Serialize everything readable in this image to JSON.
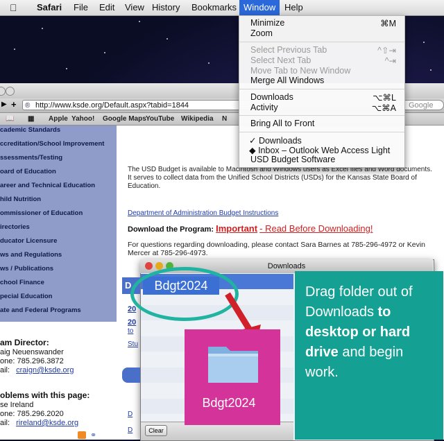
{
  "menubar": {
    "apple": "",
    "items": [
      "Safari",
      "File",
      "Edit",
      "View",
      "History",
      "Bookmarks",
      "Window",
      "Help"
    ],
    "active": "Window"
  },
  "window_menu": {
    "items": [
      {
        "label": "Minimize",
        "shortcut": "⌘M",
        "enabled": true
      },
      {
        "label": "Zoom",
        "shortcut": "",
        "enabled": true
      },
      {
        "label": "Select Previous Tab",
        "shortcut": "^⇧⇥",
        "enabled": false
      },
      {
        "label": "Select Next Tab",
        "shortcut": "^⇥",
        "enabled": false
      },
      {
        "label": "Move Tab to New Window",
        "shortcut": "",
        "enabled": false
      },
      {
        "label": "Merge All Windows",
        "shortcut": "",
        "enabled": true
      },
      {
        "label": "Downloads",
        "shortcut": "⌥⌘L",
        "enabled": true
      },
      {
        "label": "Activity",
        "shortcut": "⌥⌘A",
        "enabled": true
      },
      {
        "label": "Bring All to Front",
        "shortcut": "",
        "enabled": true
      },
      {
        "label": "✓ Downloads",
        "shortcut": "",
        "enabled": true
      },
      {
        "label": "◆ Inbox – Outlook Web Access Light",
        "shortcut": "",
        "enabled": true
      },
      {
        "label": "USD Budget Software",
        "shortcut": "",
        "enabled": true
      }
    ]
  },
  "browser": {
    "url": "http://www.ksde.org/Default.aspx?tabid=1844",
    "search_placeholder": "Google",
    "bookmarks": [
      "Apple",
      "Yahoo!",
      "Google Maps",
      "YouTube",
      "Wikipedia",
      "N"
    ]
  },
  "sidebar": {
    "items": [
      "cademic Standards",
      "ccreditation/School Improvement",
      "ssessments/Testing",
      "oard of Education",
      "areer and Technical Education",
      "hild Nutrition",
      "ommissioner of Education",
      "irectories",
      "ducator Licensure",
      "ws and Regulations",
      "ws / Publications",
      "chool Finance",
      "pecial Education",
      "ate and Federal Programs"
    ],
    "contact": {
      "team_title": "am Director:",
      "team_name": "aig Neuenswander",
      "team_phone": "one:  785.296.3872",
      "team_email_label": "ail:",
      "team_email": "craign@ksde.org",
      "problems_title": "oblems with this page:",
      "problems_name": "se Ireland",
      "problems_phone": "one:  785.296.2020",
      "problems_email_label": "ail:",
      "problems_email": "rireland@ksde.org"
    }
  },
  "content": {
    "intro": "The USD Budget is available to Macintosh and Windows users as Excel files and Word documents. It serves to collect data from the Unified School Districts (USDs) for the Kansas State Board of Education.",
    "admin_link": "Department of Administration Budget Instructions",
    "download_label": "Download the Program:",
    "important": "Important",
    "important_rest": "- Read Before Downloading!",
    "questions": "For questions regarding downloading, please contact Sara Barnes at 785-296-4972 or Kevin Mercer at 785-296-4973.",
    "frag_1": "20",
    "frag_2": "20",
    "frag_3": "to",
    "frag_4": "Stu",
    "frag_5": "D",
    "frag_6": "D",
    "frag_7": "D"
  },
  "downloads_window": {
    "title": "Downloads",
    "clear_label": "Clear"
  },
  "overlay": {
    "file_label": "Bdgt2024",
    "folder_caption": "Bdgt2024",
    "callout_1": "Drag folder out of Downloads ",
    "callout_2": "to desktop or hard drive",
    "callout_3": " and begin work."
  },
  "colors": {
    "accent_teal": "#14a092",
    "ellipse": "#1fb3a0",
    "magenta": "#d4349a",
    "arrow": "#d0202a",
    "menu_highlight": "#2b68d9",
    "sidebar": "#8f9bc8"
  }
}
